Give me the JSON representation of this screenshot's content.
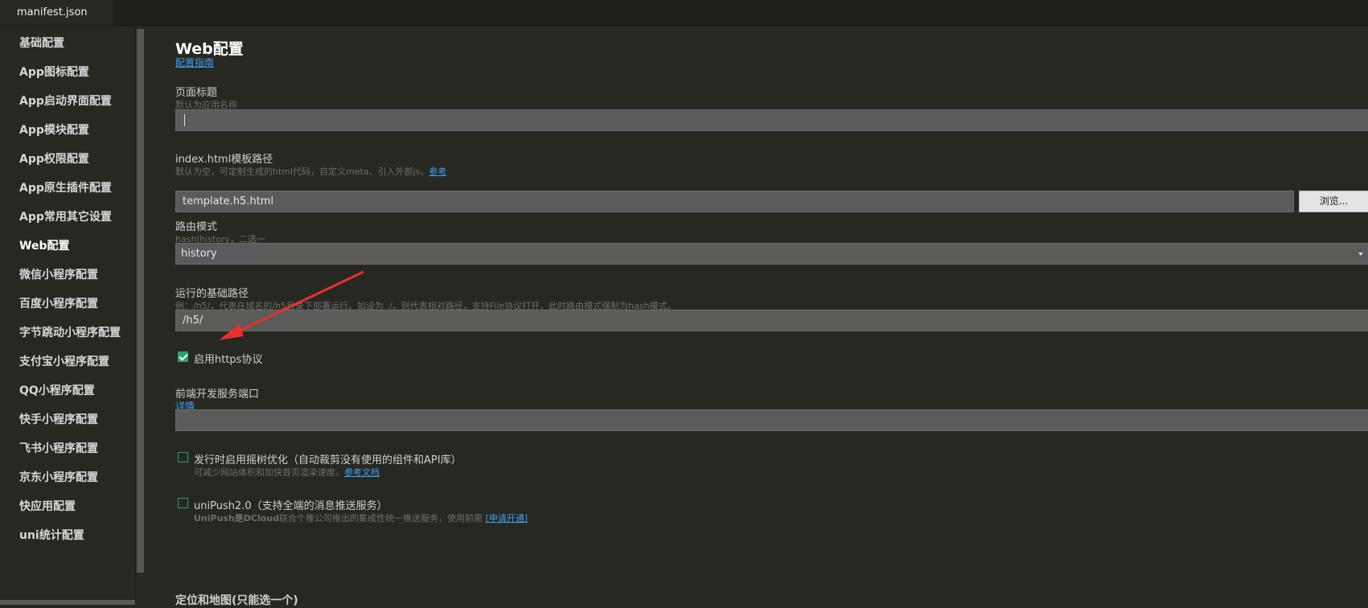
{
  "tab": {
    "label": "manifest.json"
  },
  "sidebar": {
    "items": [
      {
        "label": "基础配置"
      },
      {
        "label": "App图标配置"
      },
      {
        "label": "App启动界面配置"
      },
      {
        "label": "App模块配置"
      },
      {
        "label": "App权限配置"
      },
      {
        "label": "App原生插件配置"
      },
      {
        "label": "App常用其它设置"
      },
      {
        "label": "Web配置"
      },
      {
        "label": "微信小程序配置"
      },
      {
        "label": "百度小程序配置"
      },
      {
        "label": "字节跳动小程序配置"
      },
      {
        "label": "支付宝小程序配置"
      },
      {
        "label": "QQ小程序配置"
      },
      {
        "label": "快手小程序配置"
      },
      {
        "label": "飞书小程序配置"
      },
      {
        "label": "京东小程序配置"
      },
      {
        "label": "快应用配置"
      },
      {
        "label": "uni统计配置"
      }
    ],
    "active_index": 7
  },
  "main": {
    "title": "Web配置",
    "guide_link": "配置指南",
    "page_title": {
      "label": "页面标题",
      "hint": "默认为应用名称",
      "value": ""
    },
    "template": {
      "label": "index.html模板路径",
      "hint": "默认为空，可定制生成的html代码，自定义meta、引入外部js，",
      "hint_link": "参考",
      "value": "template.h5.html",
      "browse_label": "浏览..."
    },
    "router": {
      "label": "路由模式",
      "hint": "hash|history，二选一",
      "value": "history"
    },
    "base_path": {
      "label": "运行的基础路径",
      "hint": "例：/h5/，代表在域名的/h5目录下部署运行。如设为 ./，则代表相对路径，支持File协议打开，此时路由模式强制为hash模式。",
      "value": "/h5/"
    },
    "https": {
      "label": "启用https协议",
      "checked": true
    },
    "dev_port": {
      "label": "前端开发服务端口",
      "link": "详情",
      "value": ""
    },
    "tree_shaking": {
      "label": "发行时启用摇树优化（自动裁剪没有使用的组件和API库）",
      "hint": "可减少网站体积和加快首页渲染速度。",
      "hint_link": "参考文档",
      "checked": false
    },
    "unipush": {
      "label": "uniPush2.0（支持全端的消息推送服务）",
      "hint_bold": "UniPush是DCloud",
      "hint": "联合个推公司推出的集成性统一推送服务，使用前需",
      "hint_link": "[申请开通]",
      "checked": false
    },
    "section_map": "定位和地图(只能选一个)"
  },
  "colors": {
    "background": "#272822",
    "accent_link": "#3ea0f2",
    "checkbox": "#27a266",
    "arrow": "#e8322b"
  }
}
